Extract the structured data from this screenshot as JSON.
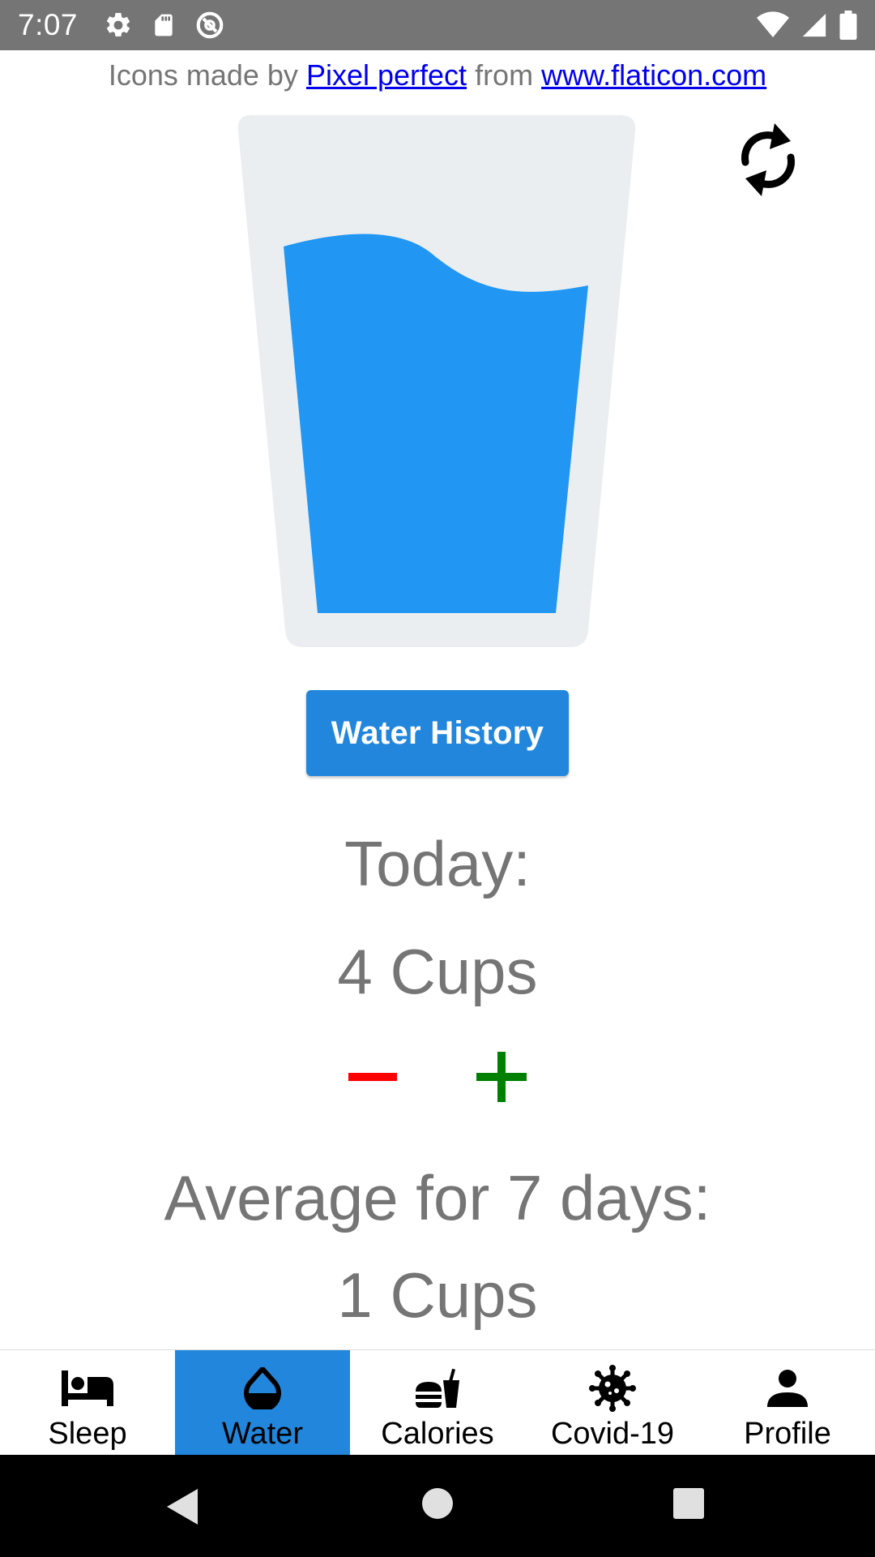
{
  "status_bar": {
    "time": "7:07",
    "left_icons": [
      "gear-icon",
      "sd-card-icon",
      "no-sync-icon"
    ],
    "right_icons": [
      "wifi-icon",
      "cell-signal-icon",
      "battery-icon"
    ]
  },
  "attribution": {
    "prefix": "Icons made by",
    "author_link": "Pixel perfect",
    "middle": "from",
    "site_link": "www.flaticon.com"
  },
  "glass": {
    "icon": "water-glass-icon",
    "glass_color": "#ebeef1",
    "water_color": "#2196f3"
  },
  "refresh": {
    "icon": "refresh-icon"
  },
  "history_button": {
    "label": "Water History",
    "color": "#2287dc"
  },
  "today": {
    "label": "Today:",
    "value": "4 Cups"
  },
  "stepper": {
    "minus_icon": "minus-icon",
    "minus_color": "#ff0000",
    "plus_icon": "plus-icon",
    "plus_color": "#008000"
  },
  "average": {
    "label": "Average for 7 days:",
    "value": "1 Cups"
  },
  "bottom_nav": {
    "active_color": "#2287dc",
    "items": [
      {
        "label": "Sleep",
        "icon": "bed-icon",
        "active": false
      },
      {
        "label": "Water",
        "icon": "water-drop-icon",
        "active": true
      },
      {
        "label": "Calories",
        "icon": "fastfood-icon",
        "active": false
      },
      {
        "label": "Covid-19",
        "icon": "virus-icon",
        "active": false
      },
      {
        "label": "Profile",
        "icon": "person-icon",
        "active": false
      }
    ]
  },
  "android_nav": [
    "back-icon",
    "home-icon",
    "recents-icon"
  ]
}
